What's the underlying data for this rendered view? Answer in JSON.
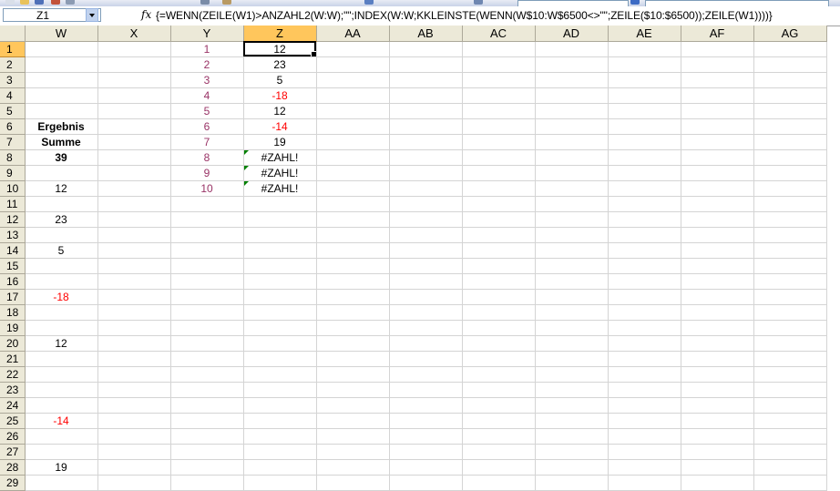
{
  "name_box": "Z1",
  "formula": "{=WENN(ZEILE(W1)>ANZAHL2(W:W);\"\";INDEX(W:W;KKLEINSTE(WENN(W$10:W$6500<>\"\";ZEILE($10:$6500));ZEILE(W1))))}",
  "columns": [
    "W",
    "X",
    "Y",
    "Z",
    "AA",
    "AB",
    "AC",
    "AD",
    "AE",
    "AF",
    "AG"
  ],
  "rows": [
    {
      "n": "1",
      "w": "",
      "y": "1",
      "z": "12"
    },
    {
      "n": "2",
      "w": "",
      "y": "2",
      "z": "23"
    },
    {
      "n": "3",
      "w": "",
      "y": "3",
      "z": "5"
    },
    {
      "n": "4",
      "w": "",
      "y": "4",
      "z": "-18"
    },
    {
      "n": "5",
      "w": "",
      "y": "5",
      "z": "12"
    },
    {
      "n": "6",
      "w": "Ergebnis",
      "y": "6",
      "z": "-14"
    },
    {
      "n": "7",
      "w": "Summe",
      "y": "7",
      "z": "19"
    },
    {
      "n": "8",
      "w": "39",
      "y": "8",
      "z": "#ZAHL!"
    },
    {
      "n": "9",
      "w": "",
      "y": "9",
      "z": "#ZAHL!"
    },
    {
      "n": "10",
      "w": "12",
      "y": "10",
      "z": "#ZAHL!"
    },
    {
      "n": "11",
      "w": "",
      "y": "",
      "z": ""
    },
    {
      "n": "12",
      "w": "23",
      "y": "",
      "z": ""
    },
    {
      "n": "13",
      "w": "",
      "y": "",
      "z": ""
    },
    {
      "n": "14",
      "w": "5",
      "y": "",
      "z": ""
    },
    {
      "n": "15",
      "w": "",
      "y": "",
      "z": ""
    },
    {
      "n": "16",
      "w": "",
      "y": "",
      "z": ""
    },
    {
      "n": "17",
      "w": "-18",
      "y": "",
      "z": ""
    },
    {
      "n": "18",
      "w": "",
      "y": "",
      "z": ""
    },
    {
      "n": "19",
      "w": "",
      "y": "",
      "z": ""
    },
    {
      "n": "20",
      "w": "12",
      "y": "",
      "z": ""
    },
    {
      "n": "21",
      "w": "",
      "y": "",
      "z": ""
    },
    {
      "n": "22",
      "w": "",
      "y": "",
      "z": ""
    },
    {
      "n": "23",
      "w": "",
      "y": "",
      "z": ""
    },
    {
      "n": "24",
      "w": "",
      "y": "",
      "z": ""
    },
    {
      "n": "25",
      "w": "-14",
      "y": "",
      "z": ""
    },
    {
      "n": "26",
      "w": "",
      "y": "",
      "z": ""
    },
    {
      "n": "27",
      "w": "",
      "y": "",
      "z": ""
    },
    {
      "n": "28",
      "w": "19",
      "y": "",
      "z": ""
    },
    {
      "n": "29",
      "w": "",
      "y": "",
      "z": ""
    }
  ],
  "colors": {
    "negative": "#ff0000",
    "index_numbers": "#993366",
    "error_marker": "#008000",
    "active_header": "#ffc65c"
  },
  "icons": [
    "fx-icon",
    "name-box-dropdown-icon",
    "error-indicator-icon"
  ]
}
